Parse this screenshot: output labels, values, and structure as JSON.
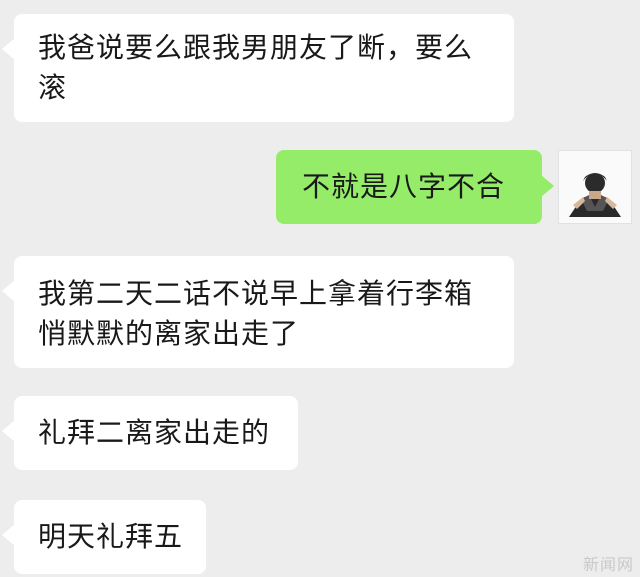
{
  "messages": [
    {
      "direction": "incoming",
      "text": "我爸说要么跟我男朋友了断，要么滚"
    },
    {
      "direction": "outgoing",
      "text": "不就是八字不合"
    },
    {
      "direction": "incoming",
      "text": "我第二天二话不说早上拿着行李箱悄默默的离家出走了"
    },
    {
      "direction": "incoming",
      "text": "礼拜二离家出走的"
    },
    {
      "direction": "incoming",
      "text": "明天礼拜五"
    }
  ],
  "watermark": "新闻网",
  "colors": {
    "background": "#ededed",
    "incoming_bubble": "#ffffff",
    "outgoing_bubble": "#95ec69",
    "text": "#191919"
  },
  "icons": {
    "avatar": "user-avatar-photo"
  }
}
